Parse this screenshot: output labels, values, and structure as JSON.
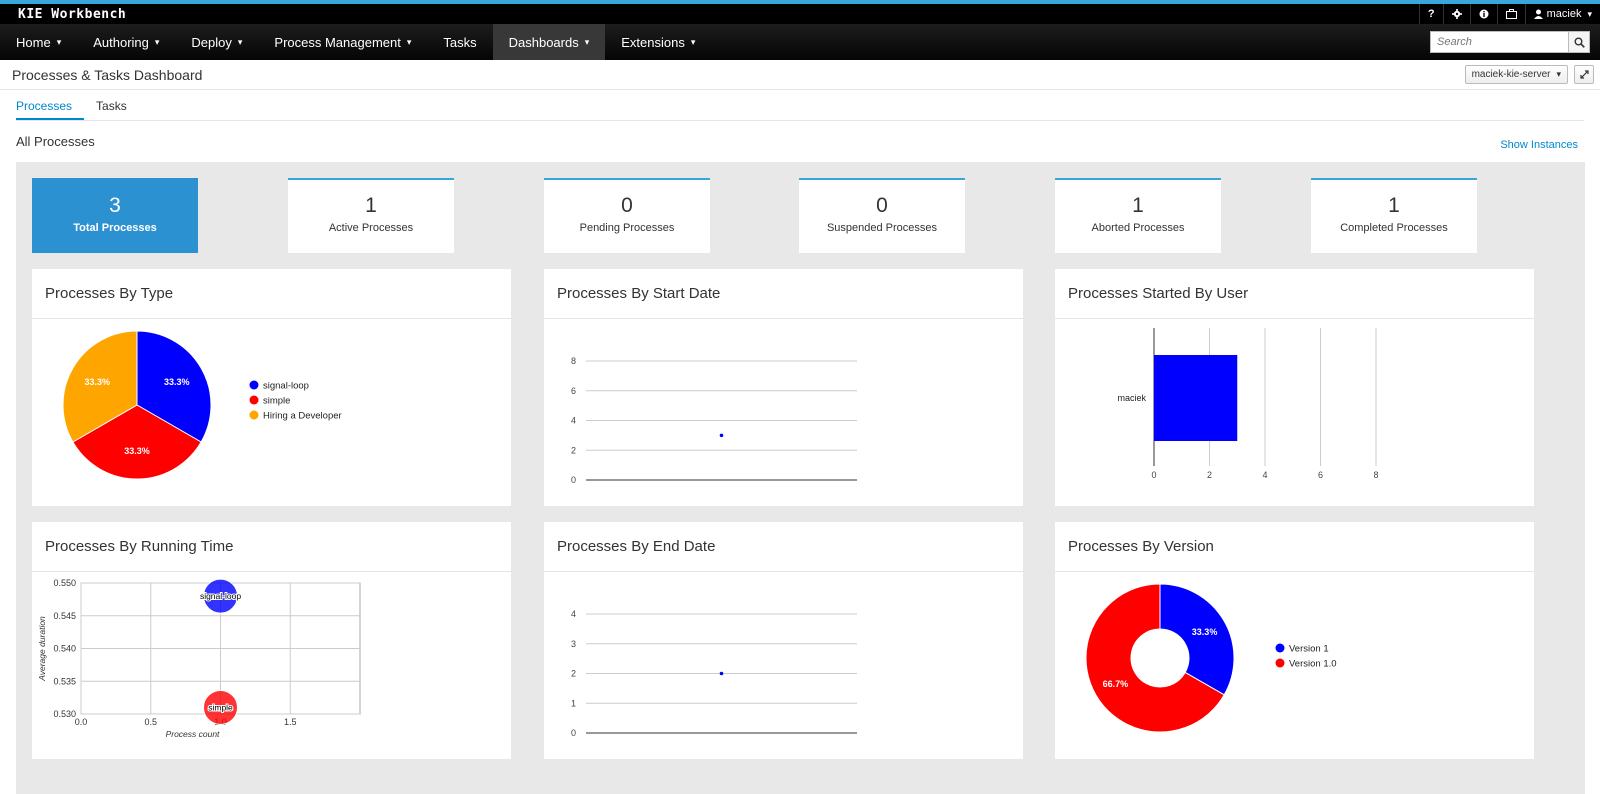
{
  "topbar": {
    "brand": "KIE Workbench",
    "help": "?",
    "settings": "⚙",
    "info": "i",
    "user": "maciek"
  },
  "nav": {
    "items": [
      {
        "label": "Home",
        "caret": true
      },
      {
        "label": "Authoring",
        "caret": true
      },
      {
        "label": "Deploy",
        "caret": true
      },
      {
        "label": "Process Management",
        "caret": true
      },
      {
        "label": "Tasks",
        "caret": false
      },
      {
        "label": "Dashboards",
        "caret": true,
        "active": true
      },
      {
        "label": "Extensions",
        "caret": true
      }
    ],
    "search_placeholder": "Search"
  },
  "page": {
    "title": "Processes & Tasks Dashboard",
    "server": "maciek-kie-server"
  },
  "tabs": [
    {
      "label": "Processes",
      "active": true
    },
    {
      "label": "Tasks",
      "active": false
    }
  ],
  "section": {
    "title": "All Processes",
    "show_instances": "Show Instances"
  },
  "summary": [
    {
      "value": "3",
      "label": "Total Processes"
    },
    {
      "value": "1",
      "label": "Active Processes"
    },
    {
      "value": "0",
      "label": "Pending Processes"
    },
    {
      "value": "0",
      "label": "Suspended Processes"
    },
    {
      "value": "1",
      "label": "Aborted Processes"
    },
    {
      "value": "1",
      "label": "Completed Processes"
    }
  ],
  "colors": {
    "accent": "#39a5dc",
    "primary_card": "#2c91d1",
    "link": "#0088ce",
    "blue": "#0000ff",
    "red": "#ff0000",
    "orange": "#ffa500"
  },
  "chart_data": [
    {
      "type": "pie",
      "title": "Processes By Type",
      "slices": [
        {
          "label": "signal-loop",
          "value": 33.3,
          "text": "33.3%",
          "color": "#0000ff"
        },
        {
          "label": "simple",
          "value": 33.3,
          "text": "33.3%",
          "color": "#ff0000"
        },
        {
          "label": "Hiring a Developer",
          "value": 33.3,
          "text": "33.3%",
          "color": "#ffa500"
        }
      ]
    },
    {
      "type": "scatter",
      "title": "Processes By Start Date",
      "yticks": [
        "0",
        "2",
        "4",
        "6",
        "8"
      ],
      "ylim": [
        0,
        8
      ],
      "points": [
        {
          "y": 3
        }
      ]
    },
    {
      "type": "bar",
      "title": "Processes Started By User",
      "orientation": "horizontal",
      "categories": [
        "maciek"
      ],
      "values": [
        3
      ],
      "xticks": [
        "0",
        "2",
        "4",
        "6",
        "8"
      ],
      "xlim": [
        0,
        8
      ],
      "color": "#0000ff"
    },
    {
      "type": "scatter",
      "title": "Processes By Running Time",
      "xlabel": "Process count",
      "ylabel": "Average duration",
      "xticks": [
        "0.0",
        "0.5",
        "1.0",
        "1.5"
      ],
      "xlim": [
        0,
        2
      ],
      "yticks": [
        "0.530",
        "0.535",
        "0.540",
        "0.545",
        "0.550"
      ],
      "ylim": [
        0.53,
        0.55
      ],
      "points": [
        {
          "label": "signal-loop",
          "x": 1.0,
          "y": 0.548,
          "color": "#0000ff"
        },
        {
          "label": "simple",
          "x": 1.0,
          "y": 0.531,
          "color": "#ff0000"
        }
      ]
    },
    {
      "type": "scatter",
      "title": "Processes By End Date",
      "yticks": [
        "0",
        "1",
        "2",
        "3",
        "4"
      ],
      "ylim": [
        0,
        4
      ],
      "points": [
        {
          "y": 2
        }
      ]
    },
    {
      "type": "pie",
      "title": "Processes By Version",
      "donut": true,
      "slices": [
        {
          "label": "Version 1",
          "value": 33.3,
          "text": "33.3%",
          "color": "#0000ff"
        },
        {
          "label": "Version 1.0",
          "value": 66.7,
          "text": "66.7%",
          "color": "#ff0000"
        }
      ]
    }
  ]
}
